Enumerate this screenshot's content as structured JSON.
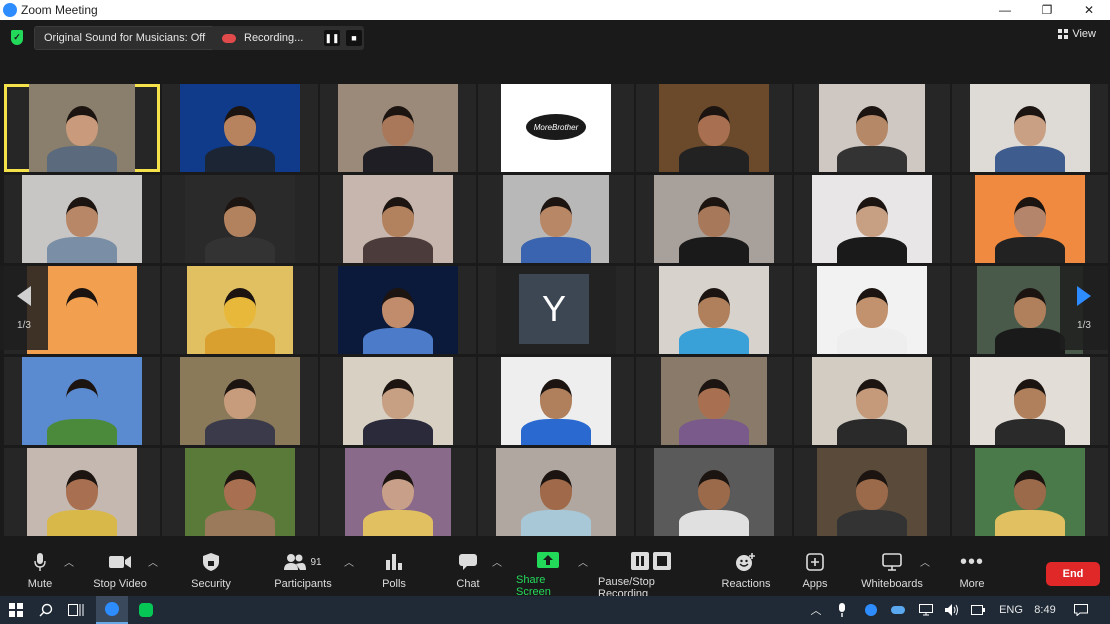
{
  "window": {
    "title": "Zoom Meeting",
    "controls": [
      "—",
      "❐",
      "✕"
    ]
  },
  "topbar": {
    "original_sound": "Original Sound for Musicians: Off",
    "recording": "Recording...",
    "pause_glyph": "❚❚",
    "stop_glyph": "■",
    "view_label": "View"
  },
  "gallery": {
    "page_left": "1/3",
    "page_right": "1/3",
    "letter_tile": "Y",
    "tiles": [
      {
        "bg": "#8a7e6c",
        "skin": "#c99a7c",
        "shirt": "#5b6a7c",
        "active": true
      },
      {
        "bg": "#0f3b8a",
        "skin": "#b7835f",
        "shirt": "#1b2533"
      },
      {
        "bg": "#9b8a7a",
        "skin": "#a9775a",
        "shirt": "#1e1e24"
      },
      {
        "bg": "#ffffff",
        "skin": "#ffffff",
        "shirt": "#ffffff",
        "logo": "MoreBrother"
      },
      {
        "bg": "#6a4a2a",
        "skin": "#a87050",
        "shirt": "#222"
      },
      {
        "bg": "#cfc8c2",
        "skin": "#b58868",
        "shirt": "#333"
      },
      {
        "bg": "#dedad6",
        "skin": "#c9a083",
        "shirt": "#3f5c8e"
      },
      {
        "bg": "#c8c6c4",
        "skin": "#b88767",
        "shirt": "#7a8fa6"
      },
      {
        "bg": "#2a2a2a",
        "skin": "#b2825f",
        "shirt": "#333"
      },
      {
        "bg": "#c7b6ad",
        "skin": "#b2825f",
        "shirt": "#4b3b3b"
      },
      {
        "bg": "#b8b8b8",
        "skin": "#b88866",
        "shirt": "#3b64b0"
      },
      {
        "bg": "#a8a09a",
        "skin": "#a7785a",
        "shirt": "#1a1a1a"
      },
      {
        "bg": "#e8e6e6",
        "skin": "#c7a084",
        "shirt": "#1a1a1a"
      },
      {
        "bg": "#f08a40",
        "skin": "#b4856a",
        "shirt": "#222"
      },
      {
        "bg": "#f2a050",
        "skin": "#f2a050",
        "shirt": "#f2a050"
      },
      {
        "bg": "#e0c060",
        "skin": "#e8b83a",
        "shirt": "#d9a030"
      },
      {
        "bg": "#0b1a3a",
        "skin": "#c08c6c",
        "shirt": "#4b7bc9"
      },
      {
        "bg": "#222",
        "skin": "#222",
        "shirt": "#222",
        "letter": true
      },
      {
        "bg": "#d7d2cb",
        "skin": "#b0805c",
        "shirt": "#3aa0d8"
      },
      {
        "bg": "#f2f2f2",
        "skin": "#c2926e",
        "shirt": "#eeeeee"
      },
      {
        "bg": "#4a5a4a",
        "skin": "#b0805c",
        "shirt": "#1a1a1a"
      },
      {
        "bg": "#5a8ad0",
        "skin": "#5a8ad0",
        "shirt": "#4a8a3a"
      },
      {
        "bg": "#8a7a5a",
        "skin": "#c79c7c",
        "shirt": "#3a3a4a"
      },
      {
        "bg": "#d8d0c2",
        "skin": "#c7a084",
        "shirt": "#2a2a3a"
      },
      {
        "bg": "#eeeeee",
        "skin": "#b0805c",
        "shirt": "#2a6ad0"
      },
      {
        "bg": "#8a7a6a",
        "skin": "#a87050",
        "shirt": "#7a5a8a"
      },
      {
        "bg": "#d2ccc2",
        "skin": "#c49a7a",
        "shirt": "#2a2a2a"
      },
      {
        "bg": "#e2ddd6",
        "skin": "#b0805c",
        "shirt": "#2a2a2a"
      },
      {
        "bg": "#c4b8b0",
        "skin": "#a87050",
        "shirt": "#d9b84a"
      },
      {
        "bg": "#5a7a3a",
        "skin": "#a87050",
        "shirt": "#9a7a5a"
      },
      {
        "bg": "#8a6a8a",
        "skin": "#c8a08a",
        "shirt": "#e0c060"
      },
      {
        "bg": "#b0a8a0",
        "skin": "#a06a4a",
        "shirt": "#a8c8d8"
      },
      {
        "bg": "#5a5a5a",
        "skin": "#9a6a4a",
        "shirt": "#e0e0e0"
      },
      {
        "bg": "#5a4a3a",
        "skin": "#9a6a4a",
        "shirt": "#333"
      },
      {
        "bg": "#4a7a4a",
        "skin": "#9a6a4a",
        "shirt": "#e0c060"
      }
    ]
  },
  "toolbar": {
    "mute": "Mute",
    "stop_video": "Stop Video",
    "security": "Security",
    "participants": "Participants",
    "participants_count": "91",
    "polls": "Polls",
    "chat": "Chat",
    "share_screen": "Share Screen",
    "pause_stop_recording": "Pause/Stop Recording",
    "reactions": "Reactions",
    "apps": "Apps",
    "whiteboards": "Whiteboards",
    "more": "More",
    "end": "End",
    "colors": {
      "accent": "#23d959",
      "end": "#e02828"
    }
  },
  "taskbar": {
    "language": "ENG",
    "time": "8:49"
  }
}
